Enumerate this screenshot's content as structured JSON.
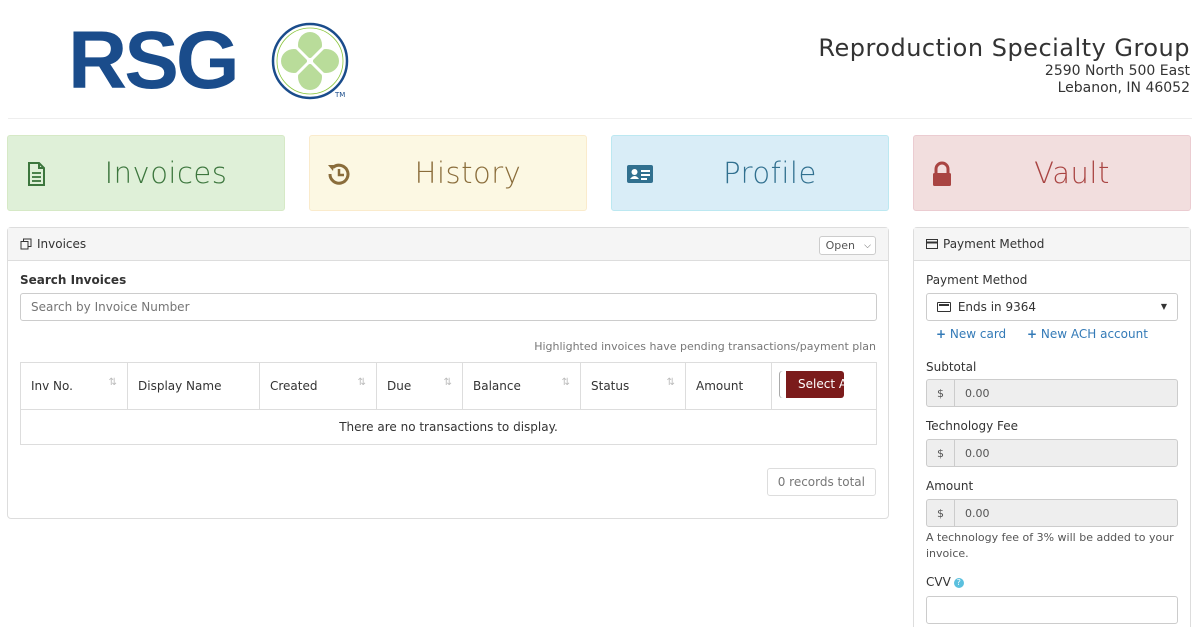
{
  "header": {
    "logo_text": "RSG",
    "logo_tm": "TM",
    "company_name": "Reproduction Specialty Group",
    "address_line1": "2590 North 500 East",
    "address_line2": "Lebanon, IN 46052"
  },
  "nav": {
    "invoices": "Invoices",
    "history": "History",
    "profile": "Profile",
    "vault": "Vault"
  },
  "invoices_panel": {
    "title": "Invoices",
    "status_filter": "Open",
    "search_label": "Search Invoices",
    "search_placeholder": "Search by Invoice Number",
    "hint": "Highlighted invoices have pending transactions/payment plan",
    "columns": [
      "Inv No.",
      "Display Name",
      "Created",
      "Due",
      "Balance",
      "Status",
      "Amount"
    ],
    "select_all_label": "Select All",
    "empty_message": "There are no transactions to display.",
    "records_total": "0 records total"
  },
  "payment_panel": {
    "title": "Payment Method",
    "method_label": "Payment Method",
    "selected_method": "Ends in 9364",
    "new_card": "New card",
    "new_ach": "New ACH account",
    "subtotal_label": "Subtotal",
    "subtotal_value": "0.00",
    "fee_label": "Technology Fee",
    "fee_value": "0.00",
    "amount_label": "Amount",
    "amount_value": "0.00",
    "currency": "$",
    "fee_note": "A technology fee of 3% will be added to your invoice.",
    "cvv_label": "CVV",
    "help": "?"
  },
  "colors": {
    "brand_blue": "#1a4c8b",
    "invoices_tile": "#dff0d8",
    "history_tile": "#fcf8e3",
    "profile_tile": "#d9edf7",
    "vault_tile": "#f2dede",
    "select_all_btn": "#7b1b1b",
    "link": "#337ab7"
  }
}
